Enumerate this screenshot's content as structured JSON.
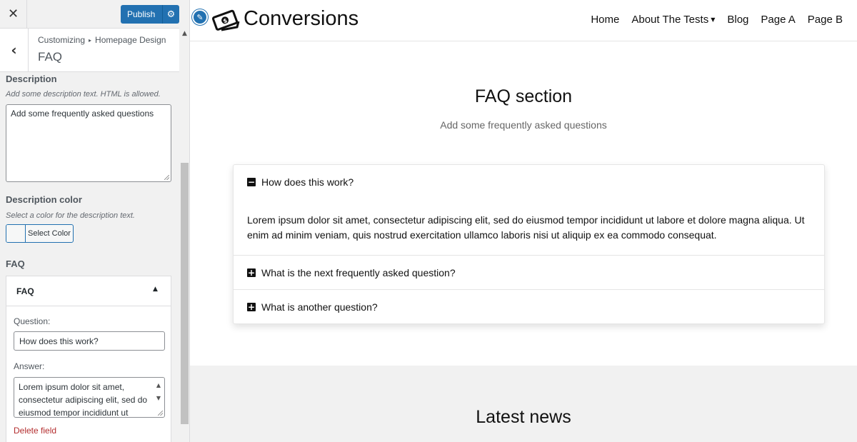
{
  "sidebar": {
    "close_glyph": "✕",
    "publish_label": "Publish",
    "gear_glyph": "⚙",
    "back_glyph": "‹",
    "breadcrumb": {
      "root": "Customizing",
      "separator": "▸",
      "parent": "Homepage Design"
    },
    "section_title": "FAQ",
    "description": {
      "label": "Description",
      "help": "Add some description text. HTML is allowed.",
      "value": "Add some frequently asked questions"
    },
    "description_color": {
      "label": "Description color",
      "help": "Select a color for the description text.",
      "button_label": "Select Color"
    },
    "faq": {
      "label": "FAQ",
      "panel_title": "FAQ",
      "caret_glyph": "▲",
      "question_label": "Question:",
      "question_value": "How does this work?",
      "answer_label": "Answer:",
      "answer_value": "Lorem ipsum dolor sit amet, consectetur adipiscing elit, sed do eiusmod tempor incididunt ut",
      "delete_label": "Delete field"
    },
    "scroll_up_glyph": "▲"
  },
  "preview": {
    "edit_glyph": "✎",
    "brand": "Conversions",
    "menu": [
      {
        "label": "Home"
      },
      {
        "label": "About The Tests",
        "has_dropdown": true
      },
      {
        "label": "Blog"
      },
      {
        "label": "Page A"
      },
      {
        "label": "Page B"
      }
    ],
    "caret_glyph": "▼",
    "faq_section": {
      "title": "FAQ section",
      "subtitle": "Add some frequently asked questions",
      "items": [
        {
          "question": "How does this work?",
          "expanded": true,
          "icon": "−",
          "answer": "Lorem ipsum dolor sit amet, consectetur adipiscing elit, sed do eiusmod tempor incididunt ut labore et dolore magna aliqua. Ut enim ad minim veniam, quis nostrud exercitation ullamco laboris nisi ut aliquip ex ea commodo consequat."
        },
        {
          "question": "What is the next frequently asked question?",
          "expanded": false,
          "icon": "+"
        },
        {
          "question": "What is another question?",
          "expanded": false,
          "icon": "+"
        }
      ]
    },
    "news_title": "Latest news"
  },
  "colors": {
    "accent": "#2271b1",
    "delete": "#b32d2e",
    "sidebar_bg": "#f1f1f1",
    "news_band_bg": "#f1f1f1"
  },
  "icons": {
    "close": "close-icon",
    "publish_settings": "gear-icon",
    "back": "chevron-left-icon",
    "collapse": "caret-up-icon",
    "edit": "pencil-icon",
    "logo": "money-logo-icon",
    "dropdown": "caret-down-icon",
    "accordion_open": "minus-square-icon",
    "accordion_closed": "plus-square-icon"
  }
}
